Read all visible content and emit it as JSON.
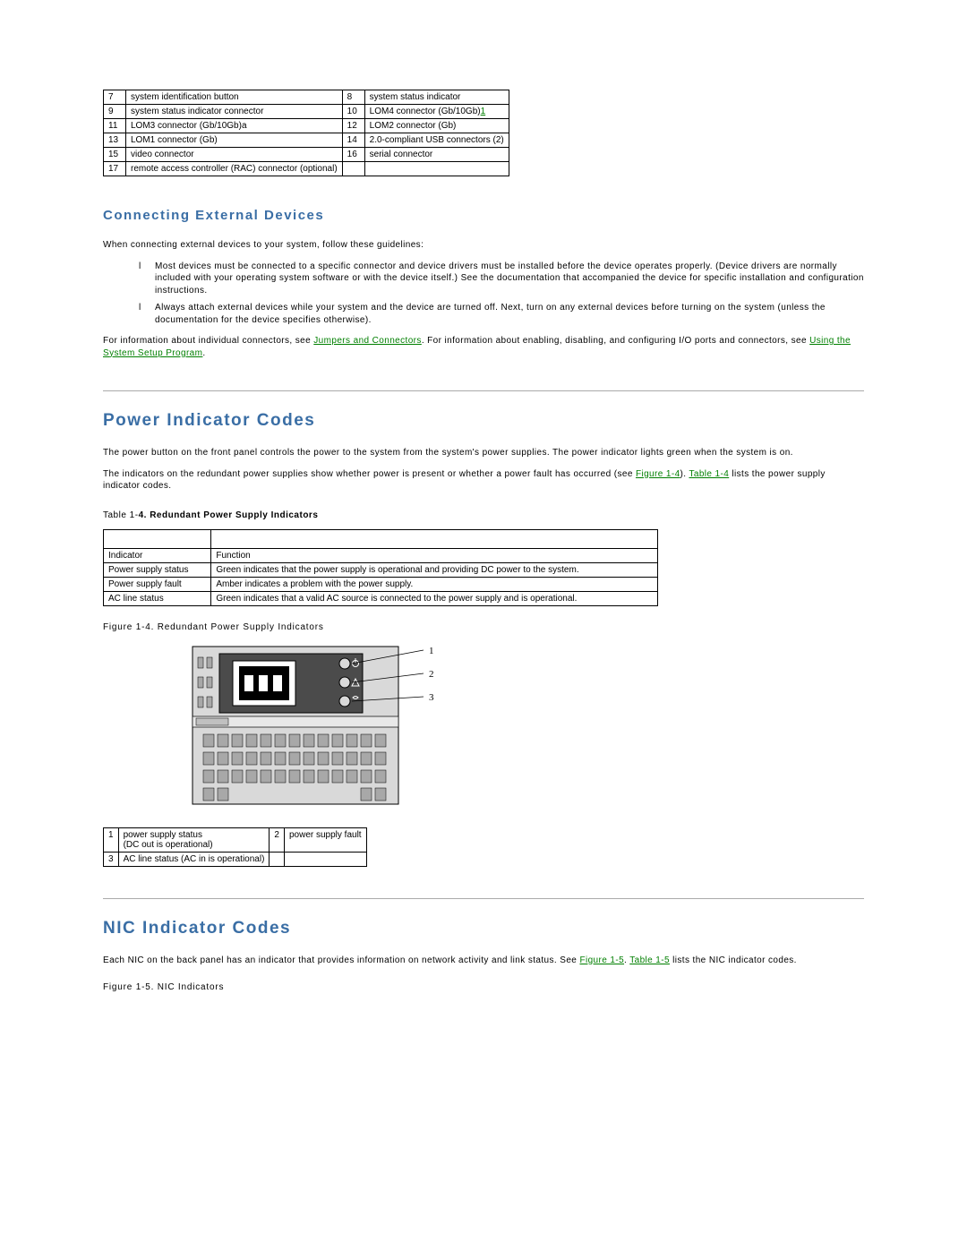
{
  "connectors_table": {
    "rows": [
      {
        "n1": "7",
        "d1": "system identification button",
        "n2": "8",
        "d2": "system status indicator"
      },
      {
        "n1": "9",
        "d1": "system status indicator connector",
        "n2": "10",
        "d2": "LOM4 connector (Gb/10Gb)",
        "footnote": "1"
      },
      {
        "n1": "11",
        "d1": "LOM3 connector (Gb/10Gb)a",
        "n2": "12",
        "d2": "LOM2 connector (Gb)"
      },
      {
        "n1": "13",
        "d1": "LOM1 connector (Gb)",
        "n2": "14",
        "d2": "2.0-compliant USB connectors (2)"
      },
      {
        "n1": "15",
        "d1": "video connector",
        "n2": "16",
        "d2": "serial connector"
      },
      {
        "n1": "17",
        "d1": "remote access controller (RAC) connector (optional)",
        "n2": "",
        "d2": ""
      }
    ]
  },
  "sections": {
    "connecting": {
      "heading": "Connecting External Devices",
      "intro": "When connecting external devices to your system, follow these guidelines:",
      "bullets": [
        "Most devices must be connected to a specific connector and device drivers must be installed before the device operates properly. (Device drivers are normally included with your operating system software or with the device itself.) See the documentation that accompanied the device for specific installation and configuration instructions.",
        "Always attach external devices while your system and the device are turned off. Next, turn on any external devices before turning on the system (unless the documentation for the device specifies otherwise)."
      ],
      "footer_pre": "For information about individual connectors, see ",
      "footer_link1": "Jumpers and Connectors",
      "footer_mid": ". For information about enabling, disabling, and configuring I/O ports and connectors, see ",
      "footer_link2": "Using the System Setup Program",
      "footer_post": "."
    },
    "power": {
      "heading": "Power Indicator Codes",
      "p1": "The power button on the front panel controls the power to the system from the system's power supplies. The power indicator lights green when the system is on.",
      "p2_pre": "The indicators on the redundant power supplies show whether power is present or whether a power fault has occurred (see ",
      "p2_link1": "Figure 1-4",
      "p2_mid": "). ",
      "p2_link2": "Table 1-4",
      "p2_post": " lists the power supply indicator codes.",
      "table_caption_prefix": "Table 1-",
      "table_caption_bold": "4. Redundant Power Supply Indicators",
      "table_headers": {
        "indicator": "Indicator",
        "function": "Function"
      },
      "table_rows": [
        {
          "ind": "Power supply status",
          "func": "Green indicates that the power supply is operational and providing DC power to the system."
        },
        {
          "ind": "Power supply fault",
          "func": "Amber indicates a problem with the power supply."
        },
        {
          "ind": "AC line status",
          "func": "Green indicates that a valid AC source is connected to the power supply and is operational."
        }
      ],
      "figure_caption": "Figure 1-4. Redundant Power Supply Indicators",
      "callouts": {
        "c1": "1",
        "c2": "2",
        "c3": "3"
      },
      "callout_table": [
        {
          "n1": "1",
          "d1": "power supply status\n(DC out is operational)",
          "n2": "2",
          "d2": "power supply fault"
        },
        {
          "n1": "3",
          "d1": "AC line status (AC in is operational)",
          "n2": "",
          "d2": ""
        }
      ]
    },
    "nic": {
      "heading": "NIC Indicator Codes",
      "p_pre": "Each NIC on the back panel has an indicator that provides information on network activity and link status. See ",
      "p_link1": "Figure 1-5",
      "p_mid": ". ",
      "p_link2": "Table 1-5",
      "p_post": " lists the NIC indicator codes.",
      "figure_caption": "Figure 1-5. NIC Indicators"
    }
  }
}
